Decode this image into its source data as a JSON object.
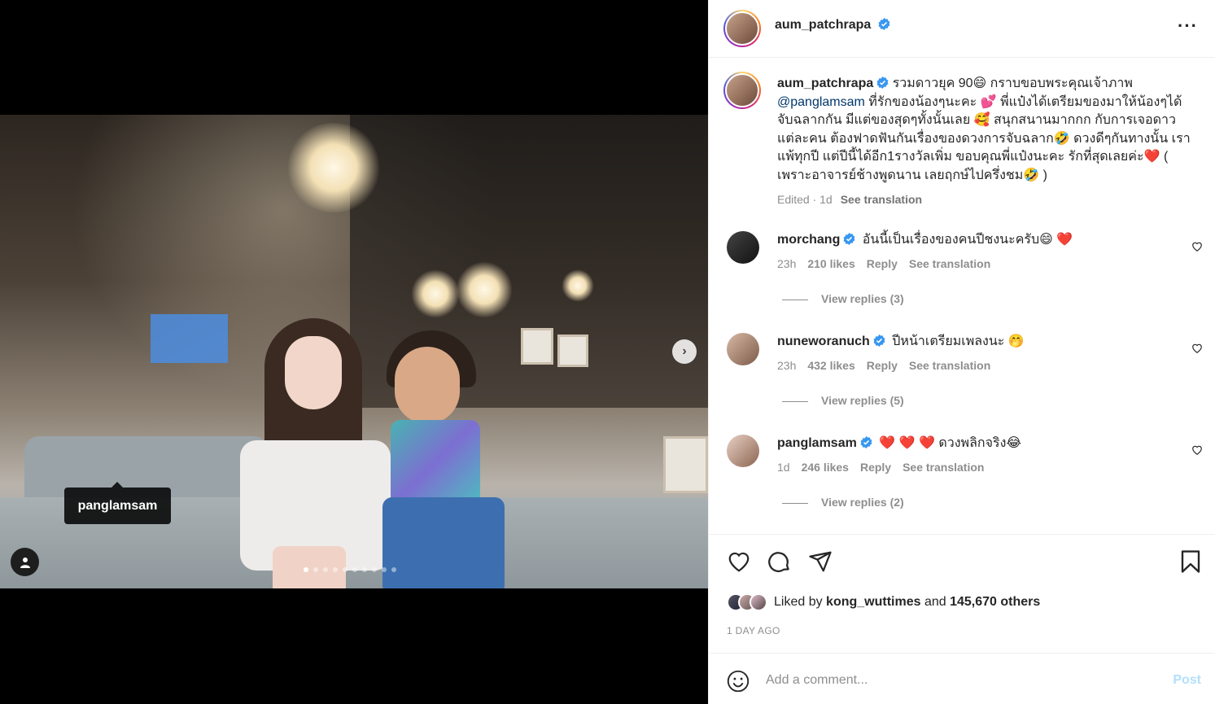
{
  "post": {
    "username": "aum_patchrapa",
    "tag_label": "panglamsam",
    "carousel_total": 10,
    "carousel_active": 0
  },
  "caption": {
    "username": "aum_patchrapa",
    "text_1": " รวมดาวยุค 90😄  กราบขอบพระคุณเจ้าภาพ ",
    "mention": "@panglamsam",
    "text_2": " ที่รักของน้องๆนะคะ 💕 พี่แป๋งได้เตรียมของมาให้น้องๆได้จับฉลากกัน มีแต่ของสุดๆทั้งนั้นเลย 🥰 สนุกสนานมากกก กับการเจอดาวแต่ละคน ต้องฟาดฟันกันเรื่องของดวงการจับฉลาก🤣 ดวงดีๆกันทางนั้น เราแพ้ทุกปี แต่ปีนี้ได้อีก1รางวัลเพิ่ม ขอบคุณพี่แป๋งนะคะ รักที่สุดเลยค่ะ❤️ ( เพราะอาจารย์ช้างพูดนาน เลยฤกษ์ไปครึ่งชม🤣 )",
    "edited": "Edited · 1d",
    "see_translation": "See translation"
  },
  "comments": [
    {
      "username": "morchang",
      "text": "อันนี้เป็นเรื่องของคนปีชงนะครับ😄 ❤️",
      "time": "23h",
      "likes": "210 likes",
      "reply": "Reply",
      "translation": "See translation",
      "view_replies": "View replies (3)"
    },
    {
      "username": "nuneworanuch",
      "text": "ปีหน้าเตรียมเพลงนะ 🤭",
      "time": "23h",
      "likes": "432 likes",
      "reply": "Reply",
      "translation": "See translation",
      "view_replies": "View replies (5)"
    },
    {
      "username": "panglamsam",
      "text": "❤️ ❤️ ❤️ ดวงพลิกจริง😂",
      "time": "1d",
      "likes": "246 likes",
      "reply": "Reply",
      "translation": "See translation",
      "view_replies": "View replies (2)"
    }
  ],
  "likes": {
    "prefix": "Liked by ",
    "user": "kong_wuttimes",
    "mid": " and ",
    "others": "145,670 others"
  },
  "timestamp": "1 DAY AGO",
  "add_comment": {
    "placeholder": "Add a comment...",
    "post_label": "Post"
  },
  "colors": {
    "verified": "#3897f0",
    "post_disabled": "#b2dffc",
    "muted": "#8e8e8e"
  }
}
